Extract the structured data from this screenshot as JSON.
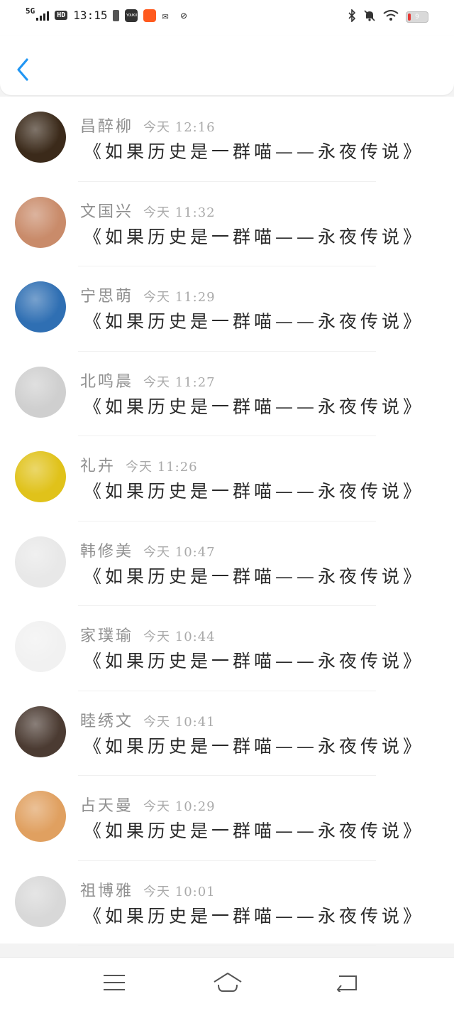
{
  "status_bar": {
    "network": "5G",
    "hd": "HD",
    "time": "13:15",
    "youku": "YOUKU",
    "battery_level": "9",
    "battery_color": "#e53935",
    "icons": [
      "signal-icon",
      "hd-icon",
      "battery-small-icon",
      "youku-icon",
      "taobao-icon",
      "wechat-icon",
      "leaf-icon",
      "bluetooth-icon",
      "mute-icon",
      "wifi-icon",
      "battery-icon"
    ]
  },
  "header": {
    "back_icon": "chevron-left-icon",
    "accent_color": "#2196f3"
  },
  "comments": [
    {
      "name": "昌醉柳",
      "time": "今天 12:16",
      "text": "《如果历史是一群喵——永夜传说》",
      "avatar_color": "#3b2a1a"
    },
    {
      "name": "文国兴",
      "time": "今天 11:32",
      "text": "《如果历史是一群喵——永夜传说》",
      "avatar_color": "#c98b6a"
    },
    {
      "name": "宁思萌",
      "time": "今天 11:29",
      "text": "《如果历史是一群喵——永夜传说》",
      "avatar_color": "#2f6fb3"
    },
    {
      "name": "北鸣晨",
      "time": "今天 11:27",
      "text": "《如果历史是一群喵——永夜传说》",
      "avatar_color": "#cfcfcf"
    },
    {
      "name": "礼卉",
      "time": "今天 11:26",
      "text": "《如果历史是一群喵——永夜传说》",
      "avatar_color": "#e0c21a"
    },
    {
      "name": "韩修美",
      "time": "今天 10:47",
      "text": "《如果历史是一群喵——永夜传说》",
      "avatar_color": "#e8e8e8"
    },
    {
      "name": "家璞瑜",
      "time": "今天 10:44",
      "text": "《如果历史是一群喵——永夜传说》",
      "avatar_color": "#f1f1f1"
    },
    {
      "name": "睦绣文",
      "time": "今天 10:41",
      "text": "《如果历史是一群喵——永夜传说》",
      "avatar_color": "#4b3b32"
    },
    {
      "name": "占天曼",
      "time": "今天 10:29",
      "text": "《如果历史是一群喵——永夜传说》",
      "avatar_color": "#e0a060"
    },
    {
      "name": "祖博雅",
      "time": "今天 10:01",
      "text": "《如果历史是一群喵——永夜传说》",
      "avatar_color": "#d8d8d8"
    }
  ],
  "nav_bar": {
    "icons": [
      "menu-icon",
      "home-icon",
      "back-icon"
    ]
  }
}
